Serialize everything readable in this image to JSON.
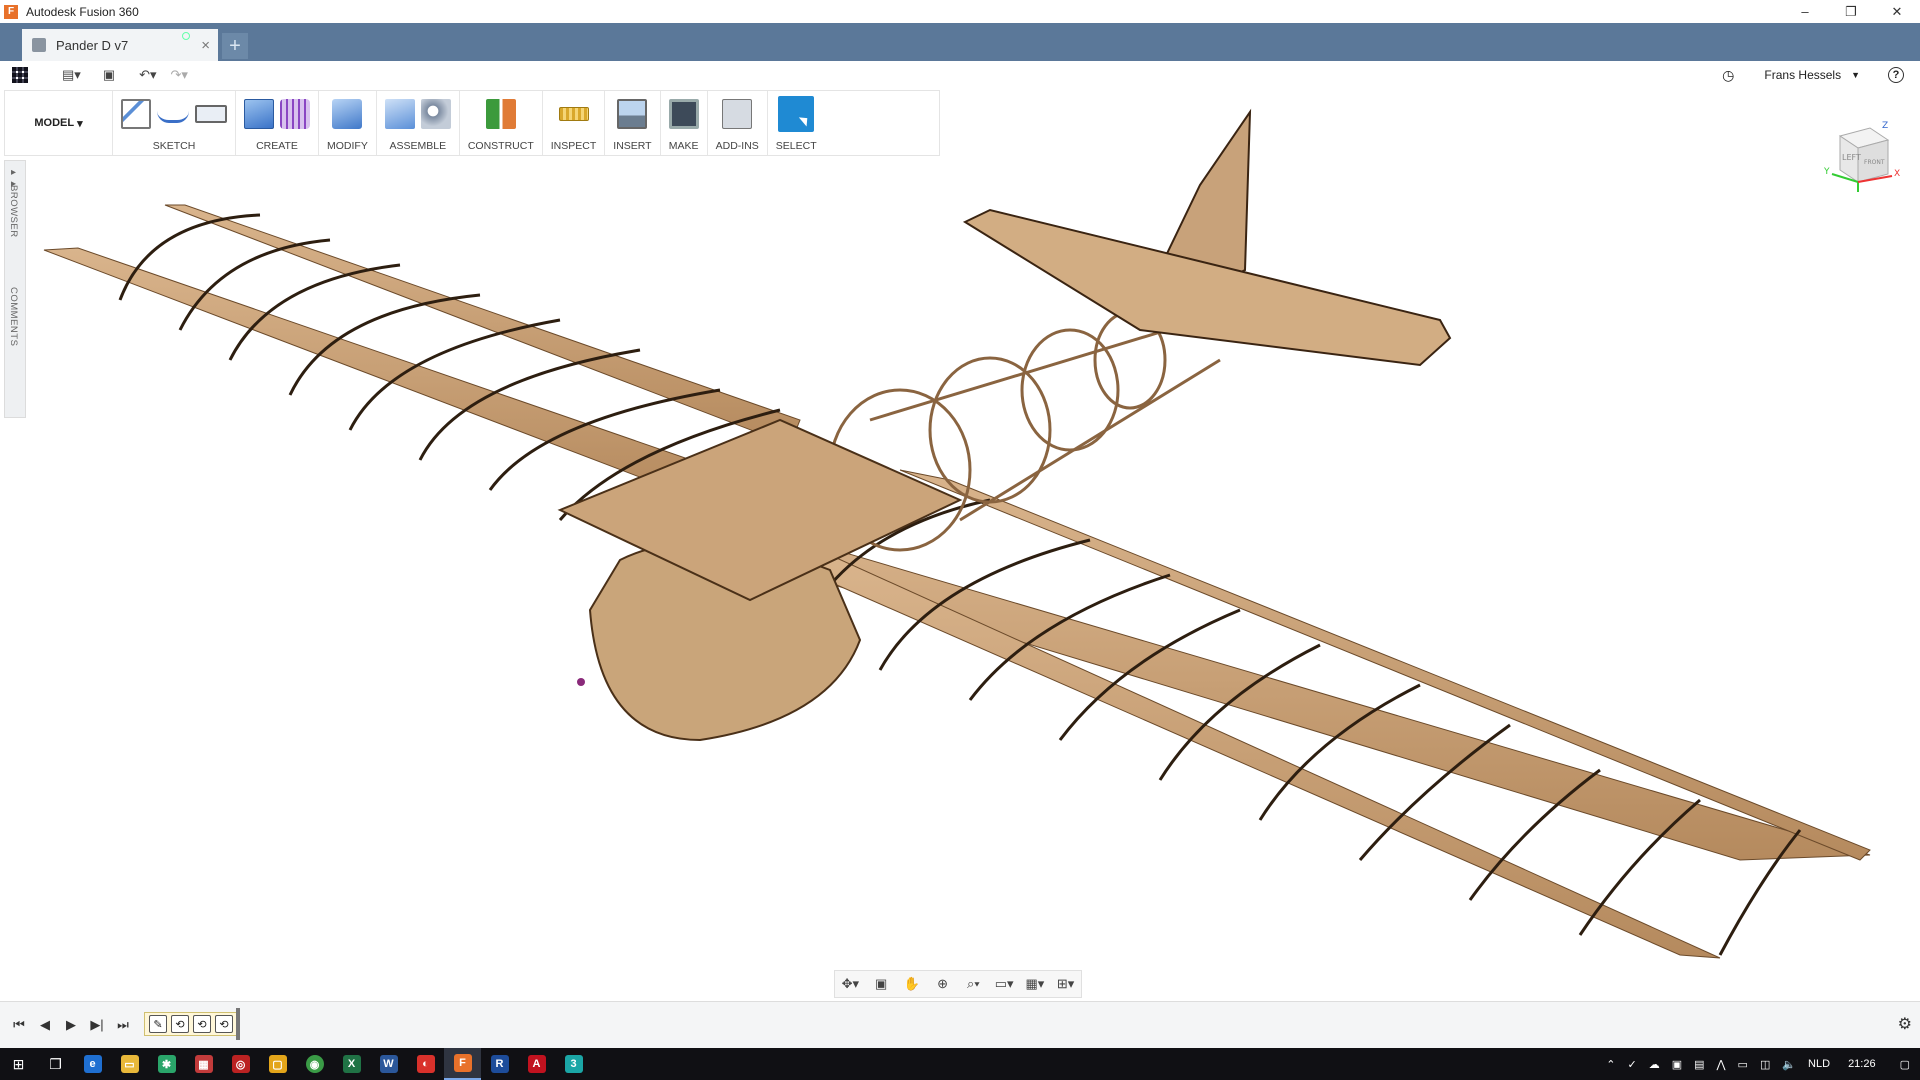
{
  "window": {
    "title": "Autodesk Fusion 360",
    "minimize": "–",
    "maximize": "❐",
    "close": "✕"
  },
  "tab": {
    "name": "Pander D v7",
    "close": "×",
    "new_tab": "+"
  },
  "quick_access": {
    "user_name": "Frans Hessels",
    "help": "?"
  },
  "toolbar": {
    "workspace": "MODEL",
    "groups": [
      "SKETCH",
      "CREATE",
      "MODIFY",
      "ASSEMBLE",
      "CONSTRUCT",
      "INSPECT",
      "INSERT",
      "MAKE",
      "ADD-INS",
      "SELECT"
    ]
  },
  "side_panel": {
    "browser": "BROWSER",
    "comments": "COMMENTS"
  },
  "viewcube": {
    "left": "LEFT",
    "front": "FRONT",
    "axis_x": "X",
    "axis_y": "Y",
    "axis_z": "Z"
  },
  "taskbar": {
    "language": "NLD",
    "time": "21:26"
  },
  "colors": {
    "tab_bar": "#5b7899",
    "wood": "#c8a27a",
    "wood_dark": "#8a6440",
    "select_blue": "#1f8ad3"
  }
}
